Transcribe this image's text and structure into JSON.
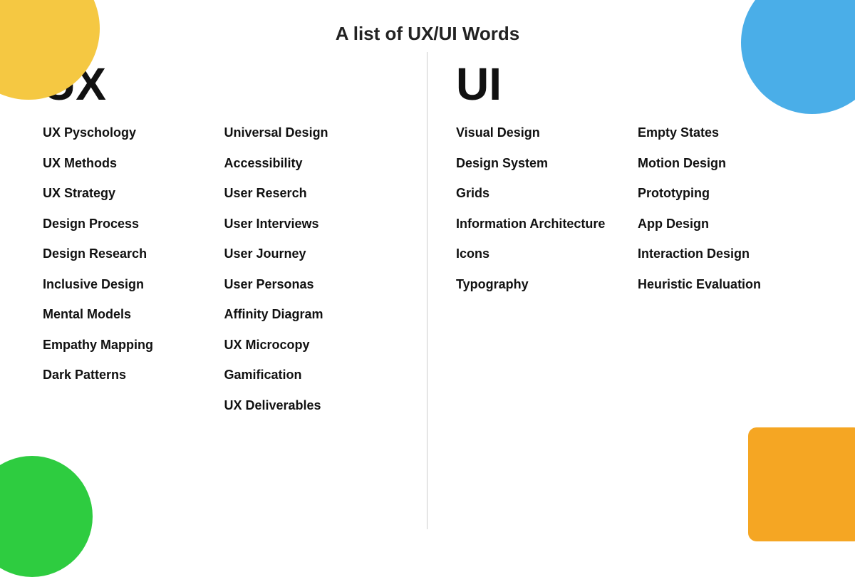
{
  "page": {
    "title": "A list of UX/UI Words"
  },
  "ux": {
    "heading": "UX",
    "col1": [
      "UX Pyschology",
      "UX Methods",
      "UX Strategy",
      "Design Process",
      "Design Research",
      "Inclusive Design",
      "Mental Models",
      "Empathy Mapping",
      "Dark Patterns"
    ],
    "col2": [
      "Universal Design",
      "Accessibility",
      "User Reserch",
      "User Interviews",
      "User Journey",
      "User Personas",
      "Affinity Diagram",
      "UX Microcopy",
      "Gamification",
      "UX Deliverables"
    ]
  },
  "ui": {
    "heading": "UI",
    "col1": [
      "Visual Design",
      "Design System",
      "Grids",
      "Information Architecture",
      "Icons",
      "Typography"
    ],
    "col2": [
      "Empty States",
      "Motion Design",
      "Prototyping",
      "App Design",
      "Interaction Design",
      "Heuristic Evaluation"
    ]
  }
}
